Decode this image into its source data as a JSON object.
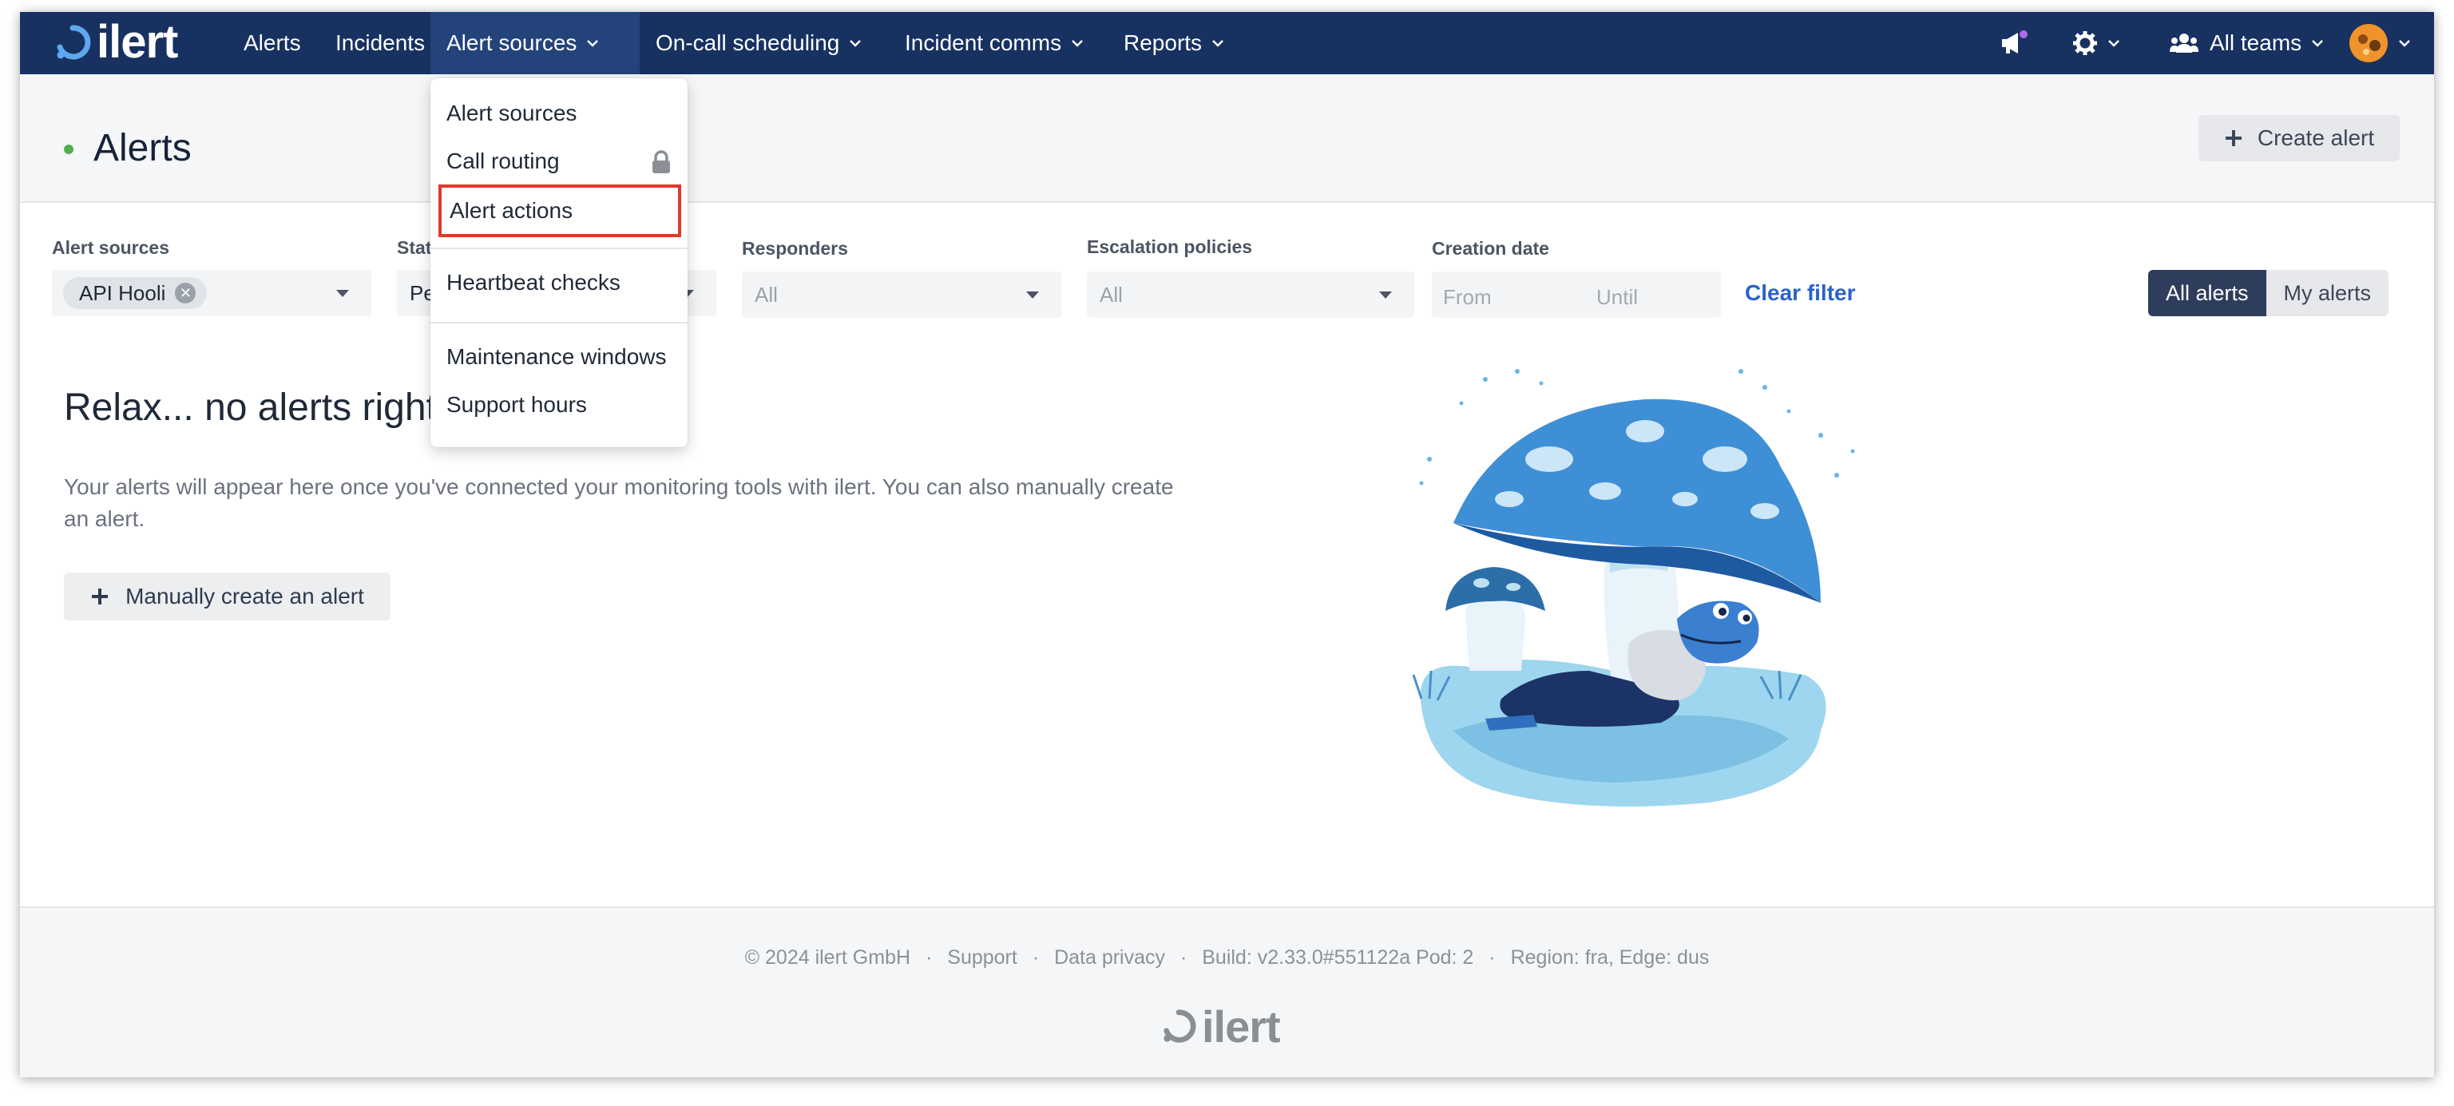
{
  "app": {
    "logo_text": "ilert"
  },
  "nav": {
    "alerts": "Alerts",
    "incidents": "Incidents",
    "alert_sources": "Alert sources",
    "oncall": "On-call scheduling",
    "incident_comms": "Incident comms",
    "reports": "Reports",
    "teams": "All teams"
  },
  "header": {
    "title": "Alerts",
    "create_label": "Create alert"
  },
  "filters": {
    "alert_sources_label": "Alert sources",
    "alert_source_chip": "API Hooli",
    "status_label": "Stat",
    "status_value": "Pe",
    "responders_label": "Responders",
    "responders_value": "All",
    "escalation_label": "Escalation policies",
    "escalation_value": "All",
    "creation_label": "Creation date",
    "from_placeholder": "From",
    "until_placeholder": "Until",
    "clear_label": "Clear filter",
    "all_alerts": "All alerts",
    "my_alerts": "My alerts"
  },
  "empty": {
    "title": "Relax... no alerts right n",
    "description": "Your alerts will appear here once you've connected your monitoring tools with ilert. You can also manually create an alert.",
    "button": "Manually create an alert"
  },
  "dropdown": {
    "items": [
      {
        "label": "Alert sources"
      },
      {
        "label": "Call routing",
        "icon": "lock-icon"
      },
      {
        "label": "Alert actions",
        "highlighted": true
      },
      {
        "label": "Heartbeat checks"
      },
      {
        "label": "Maintenance windows"
      },
      {
        "label": "Support hours"
      }
    ]
  },
  "footer": {
    "copyright": "© 2024 ilert GmbH",
    "sep": "·",
    "support": "Support",
    "privacy": "Data privacy",
    "build": "Build: v2.33.0#551122a Pod: 2",
    "region": "Region: fra, Edge: dus",
    "logo_text": "ilert"
  },
  "colors": {
    "nav_bg": "#173161",
    "status_green": "#4caf50",
    "link_blue": "#2a62c9",
    "highlight_red": "#e0392b"
  }
}
